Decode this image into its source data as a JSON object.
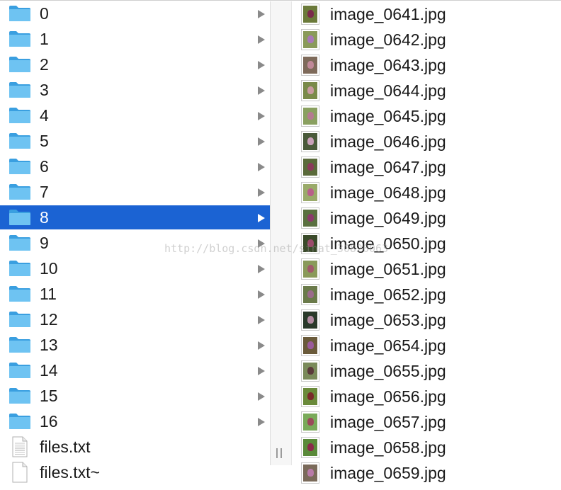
{
  "folders": [
    {
      "name": "0"
    },
    {
      "name": "1"
    },
    {
      "name": "2"
    },
    {
      "name": "3"
    },
    {
      "name": "4"
    },
    {
      "name": "5"
    },
    {
      "name": "6"
    },
    {
      "name": "7"
    },
    {
      "name": "8",
      "selected": true
    },
    {
      "name": "9"
    },
    {
      "name": "10"
    },
    {
      "name": "11"
    },
    {
      "name": "12"
    },
    {
      "name": "13"
    },
    {
      "name": "14"
    },
    {
      "name": "15"
    },
    {
      "name": "16"
    }
  ],
  "files": [
    {
      "name": "files.txt",
      "icon": "text-file-icon"
    },
    {
      "name": "files.txt~",
      "icon": "generic-file-icon"
    }
  ],
  "images": [
    {
      "name": "image_0641.jpg",
      "tint": "#6b7a3a",
      "flower": "#7a2a4a"
    },
    {
      "name": "image_0642.jpg",
      "tint": "#8a9a5a",
      "flower": "#a878b8"
    },
    {
      "name": "image_0643.jpg",
      "tint": "#7e6a5a",
      "flower": "#c08898"
    },
    {
      "name": "image_0644.jpg",
      "tint": "#7a8a4a",
      "flower": "#c89aa0"
    },
    {
      "name": "image_0645.jpg",
      "tint": "#8aa060",
      "flower": "#b47a90"
    },
    {
      "name": "image_0646.jpg",
      "tint": "#4a5a3a",
      "flower": "#c8a0b8"
    },
    {
      "name": "image_0647.jpg",
      "tint": "#5a6a3a",
      "flower": "#8a3a5a"
    },
    {
      "name": "image_0648.jpg",
      "tint": "#9aaa6a",
      "flower": "#b8608a"
    },
    {
      "name": "image_0649.jpg",
      "tint": "#5a7040",
      "flower": "#8a3a6a"
    },
    {
      "name": "image_0650.jpg",
      "tint": "#3a4a2a",
      "flower": "#9a4a6a"
    },
    {
      "name": "image_0651.jpg",
      "tint": "#8a9a5a",
      "flower": "#a05a6a"
    },
    {
      "name": "image_0652.jpg",
      "tint": "#6a7a4a",
      "flower": "#9a6a8a"
    },
    {
      "name": "image_0653.jpg",
      "tint": "#2a3a2a",
      "flower": "#b08aa0"
    },
    {
      "name": "image_0654.jpg",
      "tint": "#6a5a3a",
      "flower": "#9a5a9a"
    },
    {
      "name": "image_0655.jpg",
      "tint": "#7a8a5a",
      "flower": "#5a3a3a"
    },
    {
      "name": "image_0656.jpg",
      "tint": "#6a8a3a",
      "flower": "#7a2a2a"
    },
    {
      "name": "image_0657.jpg",
      "tint": "#7aaa5a",
      "flower": "#9a4a5a"
    },
    {
      "name": "image_0658.jpg",
      "tint": "#5a8a3a",
      "flower": "#8a2a4a"
    },
    {
      "name": "image_0659.jpg",
      "tint": "#7a6a5a",
      "flower": "#b87aa8"
    }
  ],
  "watermark": "http://blog.csdn.net/sinat_30820063",
  "colors": {
    "selection": "#1b63d3",
    "folder": "#5fbaee"
  }
}
